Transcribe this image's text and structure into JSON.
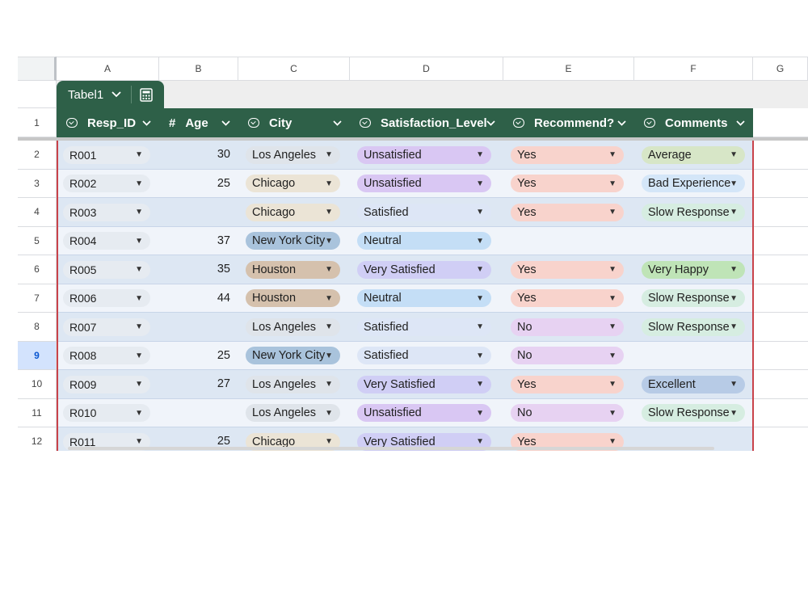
{
  "column_letters": [
    "A",
    "B",
    "C",
    "D",
    "E",
    "F",
    "G"
  ],
  "table": {
    "name": "Tabel1",
    "chevron": "⌄",
    "calc_icon": "calculator-icon"
  },
  "headers": [
    {
      "icon": "dropdown-type-icon",
      "label": "Resp_ID"
    },
    {
      "icon": "number-type-icon",
      "prefix": "#",
      "label": "Age"
    },
    {
      "icon": "dropdown-type-icon",
      "label": "City"
    },
    {
      "icon": "dropdown-type-icon",
      "label": "Satisfaction_Level"
    },
    {
      "icon": "dropdown-type-icon",
      "label": "Recommend?"
    },
    {
      "icon": "dropdown-type-icon",
      "label": "Comments"
    }
  ],
  "row_numbers": [
    "1",
    "2",
    "3",
    "4",
    "5",
    "6",
    "7",
    "8",
    "9",
    "10",
    "11",
    "12"
  ],
  "selected_row": "9",
  "colors": {
    "header_green": "#2e6048",
    "city": {
      "Los Angeles": "#dfe4ea",
      "Chicago": "#ebe4d6",
      "New York City": "#a9c3dc",
      "Houston": "#d5c1ad"
    },
    "satisfaction": {
      "Unsatisfied": "#d9c7f3",
      "Satisfied": "#dde6f6",
      "Neutral": "#c4def6",
      "Very Satisfied": "#d0cef5"
    },
    "recommend": {
      "Yes": "#f8d3cc",
      "No": "#e7d2f2"
    },
    "comments": {
      "Average": "#d7e6c7",
      "Bad Experience": "#d4e6f8",
      "Slow Response": "#d6ede1",
      "Very Happy": "#bfe4b7",
      "Excellent": "#b7cbe6"
    }
  },
  "rows": [
    {
      "id": "R001",
      "age": "30",
      "city": "Los Angeles",
      "satisfaction": "Unsatisfied",
      "recommend": "Yes",
      "comments": "Average"
    },
    {
      "id": "R002",
      "age": "25",
      "city": "Chicago",
      "satisfaction": "Unsatisfied",
      "recommend": "Yes",
      "comments": "Bad Experience"
    },
    {
      "id": "R003",
      "age": "",
      "city": "Chicago",
      "satisfaction": "Satisfied",
      "recommend": "Yes",
      "comments": "Slow Response"
    },
    {
      "id": "R004",
      "age": "37",
      "city": "New York City",
      "satisfaction": "Neutral",
      "recommend": "",
      "comments": ""
    },
    {
      "id": "R005",
      "age": "35",
      "city": "Houston",
      "satisfaction": "Very Satisfied",
      "recommend": "Yes",
      "comments": "Very Happy"
    },
    {
      "id": "R006",
      "age": "44",
      "city": "Houston",
      "satisfaction": "Neutral",
      "recommend": "Yes",
      "comments": "Slow Response"
    },
    {
      "id": "R007",
      "age": "",
      "city": "Los Angeles",
      "satisfaction": "Satisfied",
      "recommend": "No",
      "comments": "Slow Response"
    },
    {
      "id": "R008",
      "age": "25",
      "city": "New York City",
      "satisfaction": "Satisfied",
      "recommend": "No",
      "comments": ""
    },
    {
      "id": "R009",
      "age": "27",
      "city": "Los Angeles",
      "satisfaction": "Very Satisfied",
      "recommend": "Yes",
      "comments": "Excellent"
    },
    {
      "id": "R010",
      "age": "",
      "city": "Los Angeles",
      "satisfaction": "Unsatisfied",
      "recommend": "No",
      "comments": "Slow Response"
    },
    {
      "id": "R011",
      "age": "25",
      "city": "Chicago",
      "satisfaction": "Very Satisfied",
      "recommend": "Yes",
      "comments": ""
    }
  ]
}
